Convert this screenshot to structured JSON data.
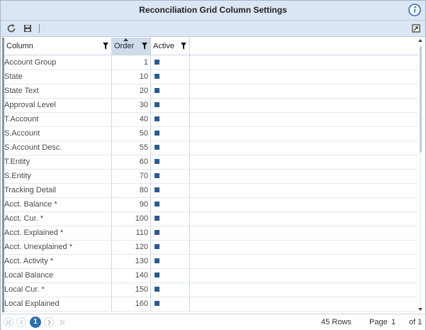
{
  "window": {
    "title": "Reconciliation Grid Column Settings"
  },
  "grid": {
    "headers": {
      "column": "Column",
      "order": "Order",
      "active": "Active"
    },
    "rows": [
      {
        "column": "Account Group",
        "order": "1"
      },
      {
        "column": "State",
        "order": "10"
      },
      {
        "column": "State Text",
        "order": "20"
      },
      {
        "column": "Approval Level",
        "order": "30"
      },
      {
        "column": "T.Account",
        "order": "40"
      },
      {
        "column": "S.Account",
        "order": "50"
      },
      {
        "column": "S.Account Desc.",
        "order": "55"
      },
      {
        "column": "T.Entity",
        "order": "60"
      },
      {
        "column": "S.Entity",
        "order": "70"
      },
      {
        "column": "Tracking Detail",
        "order": "80"
      },
      {
        "column": "Acct. Balance *",
        "order": "90"
      },
      {
        "column": "Acct. Cur. *",
        "order": "100"
      },
      {
        "column": "Acct. Explained *",
        "order": "110"
      },
      {
        "column": "Acct. Unexplained *",
        "order": "120"
      },
      {
        "column": "Acct. Activity *",
        "order": "130"
      },
      {
        "column": "Local Balance",
        "order": "140"
      },
      {
        "column": "Local Cur. *",
        "order": "150"
      },
      {
        "column": "Local Explained",
        "order": "160"
      }
    ]
  },
  "footer": {
    "current_page_button": "1",
    "rows_text": "45 Rows",
    "page_label": "Page",
    "page_value": "1",
    "page_of": "of 1"
  },
  "colors": {
    "accent": "#2c6fb3",
    "header_bg": "#dbe6f4",
    "checkbox": "#2c5a8f"
  },
  "icons": [
    "info-icon",
    "refresh-icon",
    "save-icon",
    "filter-icon",
    "sort-ascending-icon",
    "export-icon",
    "first-page-icon",
    "prev-page-icon",
    "next-page-icon",
    "last-page-icon"
  ]
}
